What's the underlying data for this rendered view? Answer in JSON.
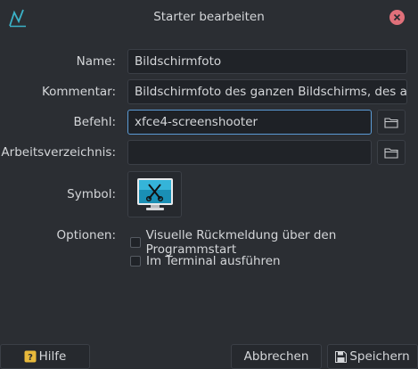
{
  "window": {
    "title": "Starter bearbeiten",
    "app_icon": "activity-graph-icon",
    "close_icon": "close-icon"
  },
  "form": {
    "name_label": "Name:",
    "name_value": "Bildschirmfoto",
    "comment_label": "Kommentar:",
    "comment_value": "Bildschirmfoto des ganzen Bildschirms, des aktuell",
    "command_label": "Befehl:",
    "command_value": "xfce4-screenshooter",
    "workdir_label": "Arbeitsverzeichnis:",
    "workdir_value": "",
    "symbol_label": "Symbol:",
    "symbol_icon": "screenshot-icon",
    "folder_icon": "folder-icon"
  },
  "options": {
    "label": "Optionen:",
    "visual_feedback": "Visuelle Rückmeldung über den Programmstart",
    "run_in_terminal": "Im Terminal ausführen"
  },
  "buttons": {
    "help": "Hilfe",
    "help_icon": "help-icon",
    "cancel": "Abbrechen",
    "save": "Speichern",
    "save_icon": "save-icon"
  },
  "colors": {
    "background": "#2b2e33",
    "field_background": "#202328",
    "focus_border": "#5b9bd5",
    "close_button": "#e0707a",
    "accent_icon": "#3bb2c8"
  }
}
